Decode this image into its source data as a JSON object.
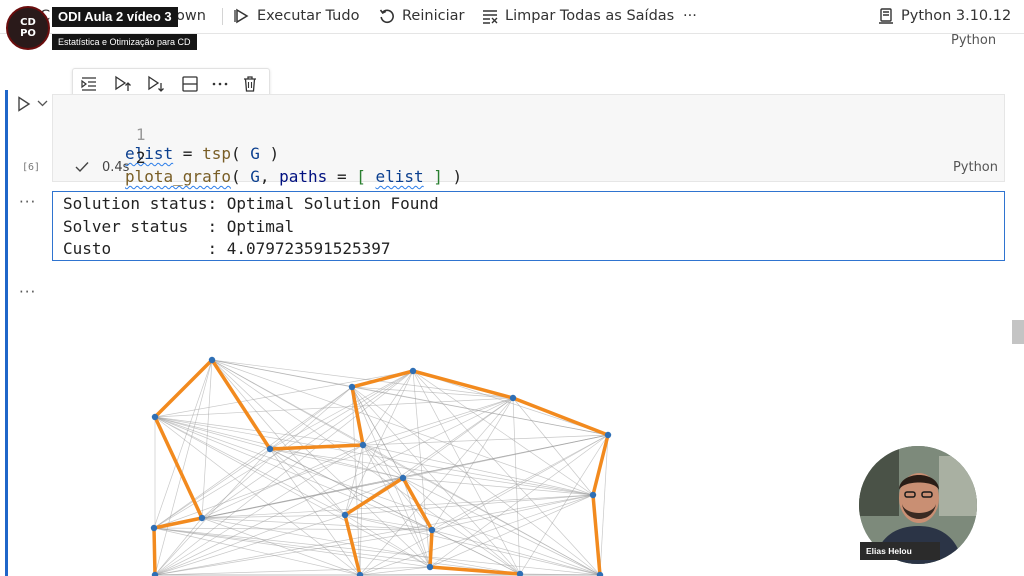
{
  "overlay": {
    "logo_line1": "CD",
    "logo_line2": "PO",
    "video_title": "ODI Aula 2 vídeo 3",
    "course": "Estatística e Otimização para CD"
  },
  "toolbar": {
    "partial_left": "C",
    "partial_markdown": "own",
    "run_all": "Executar Tudo",
    "restart": "Reiniciar",
    "clear_outputs": "Limpar Todas as Saídas",
    "more": "···",
    "kernel": "Python 3.10.12"
  },
  "prev_cell": {
    "language": "Python"
  },
  "cell": {
    "exec_count": "[6]",
    "duration": "0.4s",
    "language": "Python",
    "lines": [
      {
        "num": "1",
        "t1": "elist",
        "t2": " = ",
        "t3": "tsp",
        "t4": "( ",
        "t5": "G",
        "t6": " )"
      },
      {
        "num": "2",
        "t1": "plota_grafo",
        "t2": "( ",
        "t3": "G",
        "t4": ", ",
        "t5": "paths",
        "t6": " = ",
        "t7": "[ ",
        "t8": "elist",
        "t9": " ]",
        "t10": " )"
      }
    ]
  },
  "output": {
    "more": "···",
    "lines": [
      "Solution status: Optimal Solution Found",
      "Solver status  : Optimal",
      "Custo          : 4.079723591525397"
    ]
  },
  "plot_output": {
    "more": "···"
  },
  "webcam": {
    "name": "Elias Helou"
  },
  "colors": {
    "accent": "#1f66c9",
    "tour": "#f28a1e",
    "node": "#2f6fb5",
    "edge": "#9a9a9a"
  }
}
